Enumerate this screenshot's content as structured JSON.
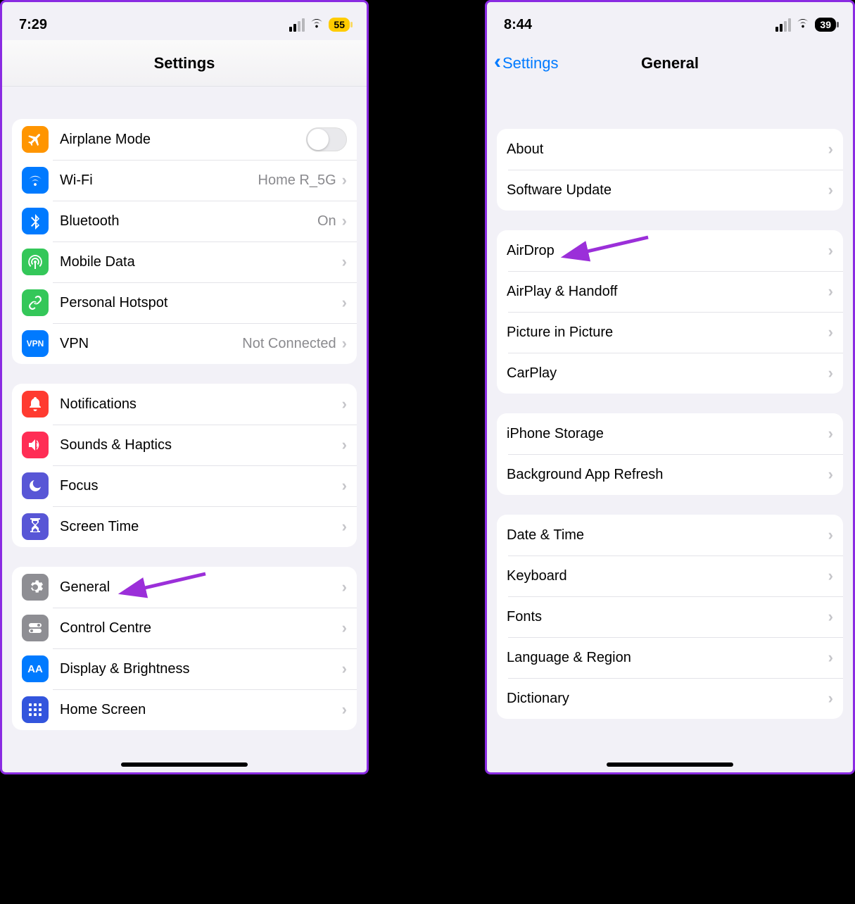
{
  "left": {
    "status": {
      "time": "7:29",
      "battery": "55"
    },
    "title": "Settings",
    "groups": [
      {
        "rows": [
          {
            "id": "airplane",
            "label": "Airplane Mode",
            "toggle": true,
            "icon": "airplane",
            "color": "#ff9500"
          },
          {
            "id": "wifi",
            "label": "Wi-Fi",
            "value": "Home R_5G",
            "icon": "wifi",
            "color": "#007aff"
          },
          {
            "id": "bluetooth",
            "label": "Bluetooth",
            "value": "On",
            "icon": "bluetooth",
            "color": "#007aff"
          },
          {
            "id": "mobile-data",
            "label": "Mobile Data",
            "icon": "antenna",
            "color": "#34c759"
          },
          {
            "id": "hotspot",
            "label": "Personal Hotspot",
            "icon": "link",
            "color": "#34c759"
          },
          {
            "id": "vpn",
            "label": "VPN",
            "value": "Not Connected",
            "icon": "vpn",
            "color": "#007aff"
          }
        ]
      },
      {
        "rows": [
          {
            "id": "notifications",
            "label": "Notifications",
            "icon": "bell",
            "color": "#ff3b30"
          },
          {
            "id": "sounds",
            "label": "Sounds & Haptics",
            "icon": "speaker",
            "color": "#ff2d55"
          },
          {
            "id": "focus",
            "label": "Focus",
            "icon": "moon",
            "color": "#5856d6"
          },
          {
            "id": "screen-time",
            "label": "Screen Time",
            "icon": "hourglass",
            "color": "#5856d6"
          }
        ]
      },
      {
        "rows": [
          {
            "id": "general",
            "label": "General",
            "icon": "gear",
            "color": "#8e8e93"
          },
          {
            "id": "control-centre",
            "label": "Control Centre",
            "icon": "toggles",
            "color": "#8e8e93"
          },
          {
            "id": "display",
            "label": "Display & Brightness",
            "icon": "aa",
            "color": "#007aff"
          },
          {
            "id": "home-screen",
            "label": "Home Screen",
            "icon": "grid",
            "color": "#3355dd"
          }
        ]
      }
    ],
    "arrow_target": "general"
  },
  "right": {
    "status": {
      "time": "8:44",
      "battery": "39"
    },
    "back": "Settings",
    "title": "General",
    "groups": [
      {
        "rows": [
          {
            "id": "about",
            "label": "About"
          },
          {
            "id": "software-update",
            "label": "Software Update"
          }
        ]
      },
      {
        "rows": [
          {
            "id": "airdrop",
            "label": "AirDrop"
          },
          {
            "id": "airplay",
            "label": "AirPlay & Handoff"
          },
          {
            "id": "pip",
            "label": "Picture in Picture"
          },
          {
            "id": "carplay",
            "label": "CarPlay"
          }
        ]
      },
      {
        "rows": [
          {
            "id": "storage",
            "label": "iPhone Storage"
          },
          {
            "id": "bg-refresh",
            "label": "Background App Refresh"
          }
        ]
      },
      {
        "rows": [
          {
            "id": "date-time",
            "label": "Date & Time"
          },
          {
            "id": "keyboard",
            "label": "Keyboard"
          },
          {
            "id": "fonts",
            "label": "Fonts"
          },
          {
            "id": "language",
            "label": "Language & Region"
          },
          {
            "id": "dictionary",
            "label": "Dictionary"
          }
        ]
      }
    ],
    "arrow_target": "airdrop"
  },
  "icons": {
    "vpn_text": "VPN",
    "aa_text": "AA"
  }
}
